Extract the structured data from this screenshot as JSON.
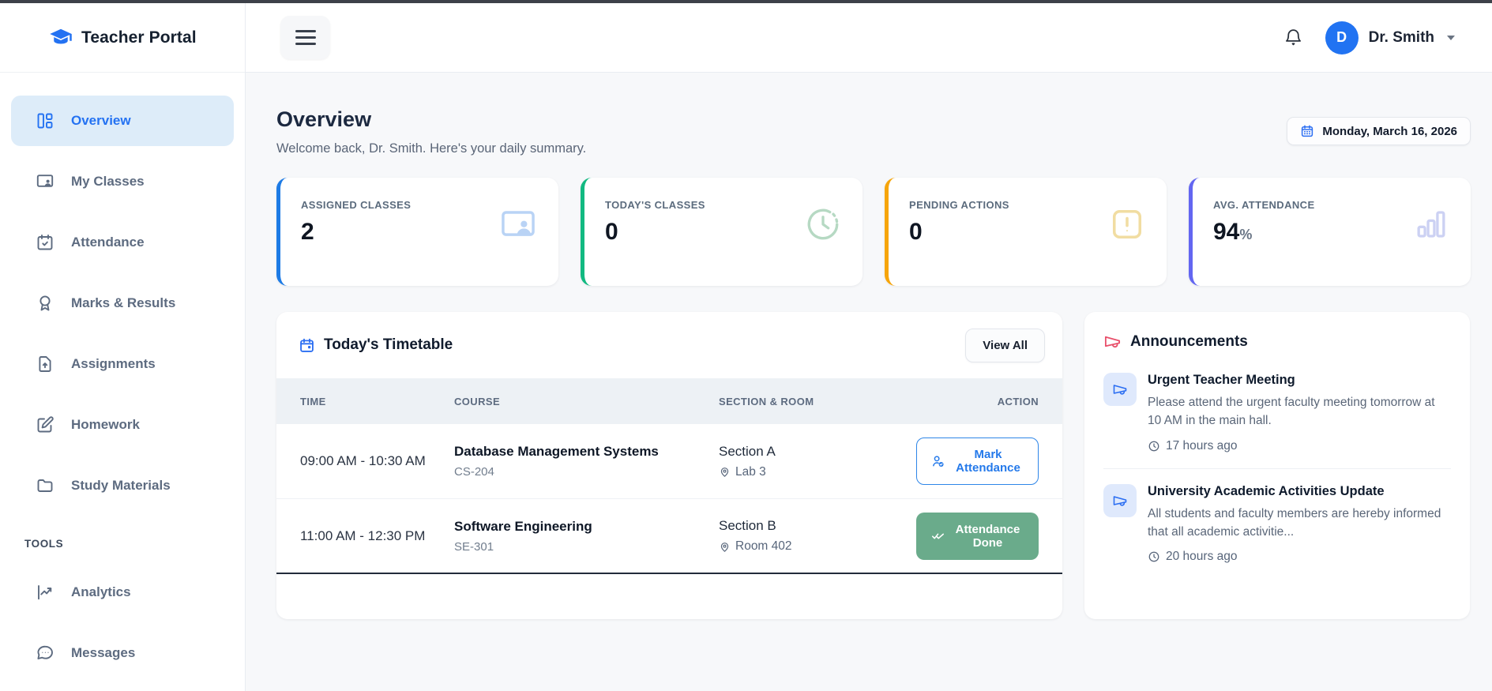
{
  "app": {
    "title": "Teacher Portal"
  },
  "topbar": {
    "user_name": "Dr. Smith",
    "avatar_initial": "D"
  },
  "sidebar": {
    "items": [
      {
        "label": "Overview",
        "icon": "dashboard-icon",
        "active": true
      },
      {
        "label": "My Classes",
        "icon": "screen-user-icon",
        "active": false
      },
      {
        "label": "Attendance",
        "icon": "calendar-check-icon",
        "active": false
      },
      {
        "label": "Marks & Results",
        "icon": "medal-icon",
        "active": false
      },
      {
        "label": "Assignments",
        "icon": "file-upload-icon",
        "active": false
      },
      {
        "label": "Homework",
        "icon": "edit-square-icon",
        "active": false
      },
      {
        "label": "Study Materials",
        "icon": "folder-icon",
        "active": false
      }
    ],
    "tools_label": "TOOLS",
    "tools_items": [
      {
        "label": "Analytics",
        "icon": "line-chart-icon",
        "active": false
      },
      {
        "label": "Messages",
        "icon": "chat-icon",
        "active": false
      }
    ]
  },
  "page": {
    "title": "Overview",
    "subtitle": "Welcome back, Dr. Smith. Here's your daily summary.",
    "date": "Monday, March 16, 2026"
  },
  "stats": [
    {
      "label": "ASSIGNED CLASSES",
      "value": "2",
      "suffix": "",
      "accent": "#1d7be5",
      "icon": "screen-user-icon"
    },
    {
      "label": "TODAY'S CLASSES",
      "value": "0",
      "suffix": "",
      "accent": "#12b981",
      "icon": "clock-icon"
    },
    {
      "label": "PENDING ACTIONS",
      "value": "0",
      "suffix": "",
      "accent": "#f6a50b",
      "icon": "alert-square-icon"
    },
    {
      "label": "AVG. ATTENDANCE",
      "value": "94",
      "suffix": "%",
      "accent": "#6366f1",
      "icon": "bar-chart-icon"
    }
  ],
  "timetable": {
    "title": "Today's Timetable",
    "view_all_label": "View All",
    "columns": {
      "time": "TIME",
      "course": "COURSE",
      "section": "SECTION & ROOM",
      "action": "ACTION"
    },
    "rows": [
      {
        "time": "09:00 AM - 10:30 AM",
        "course": "Database Management Systems",
        "code": "CS-204",
        "section": "Section A",
        "room": "Lab 3",
        "action": "Mark Attendance",
        "action_type": "outline"
      },
      {
        "time": "11:00 AM - 12:30 PM",
        "course": "Software Engineering",
        "code": "SE-301",
        "section": "Section B",
        "room": "Room 402",
        "action": "Attendance Done",
        "action_type": "done"
      }
    ]
  },
  "announcements": {
    "title": "Announcements",
    "items": [
      {
        "title": "Urgent Teacher Meeting",
        "body": "Please attend the urgent faculty meeting tomorrow at 10 AM in the main hall.",
        "ago": "17 hours ago"
      },
      {
        "title": "University Academic Activities Update",
        "body": "All students and faculty members are hereby informed that all academic activitie...",
        "ago": "20 hours ago"
      }
    ]
  },
  "colors": {
    "brand_blue": "#2472f2",
    "accent_blue": "#1d7be5",
    "accent_green": "#12b981",
    "accent_orange": "#f6a50b",
    "accent_indigo": "#6366f1",
    "done_button_green": "#6aab8b",
    "mark_button_blue": "#2479ea",
    "announcement_red": "#e8506b",
    "active_item_bg": "#ddecf9",
    "content_bg": "#f7f8fa",
    "top_strip": "#3d4149",
    "avatar_blue": "#2173f2"
  }
}
